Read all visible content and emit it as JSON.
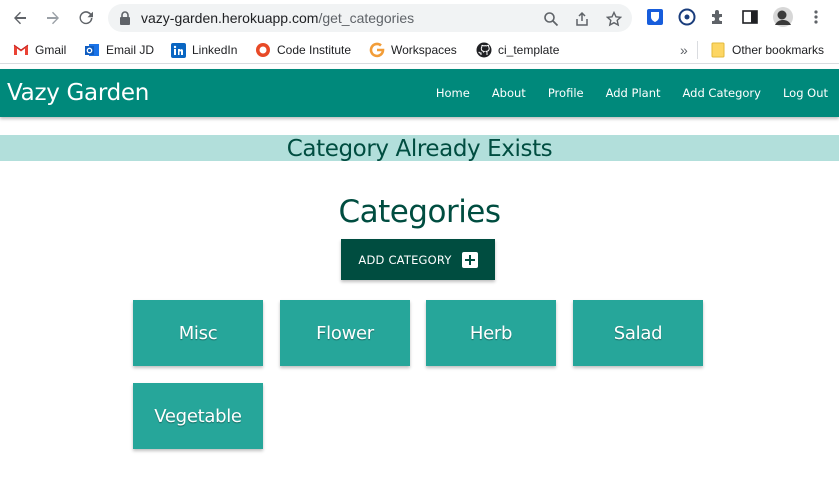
{
  "browser": {
    "url_host": "vazy-garden.herokuapp.com",
    "url_path": "/get_categories",
    "bookmarks": [
      {
        "label": "Gmail",
        "icon": "gmail-icon"
      },
      {
        "label": "Email JD",
        "icon": "outlook-icon"
      },
      {
        "label": "LinkedIn",
        "icon": "linkedin-icon"
      },
      {
        "label": "Code Institute",
        "icon": "code-institute-icon"
      },
      {
        "label": "Workspaces",
        "icon": "workspaces-icon"
      },
      {
        "label": "ci_template",
        "icon": "github-icon"
      }
    ],
    "overflow_label": "»",
    "other_bookmarks": "Other bookmarks"
  },
  "site": {
    "brand": "Vazy Garden",
    "nav": [
      "Home",
      "About",
      "Profile",
      "Add Plant",
      "Add Category",
      "Log Out"
    ]
  },
  "flash": "Category Already Exists",
  "main": {
    "title": "Categories",
    "add_button": "ADD CATEGORY",
    "categories": [
      "Misc",
      "Flower",
      "Herb",
      "Salad",
      "Vegetable"
    ]
  },
  "colors": {
    "navbar": "#00897b",
    "flash_bg": "#b2dfdb",
    "dark_teal": "#004d40",
    "card": "#26a69a"
  }
}
